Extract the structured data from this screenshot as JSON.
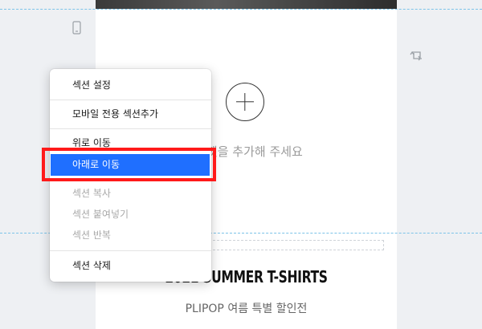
{
  "canvas": {
    "add_hint": "위젯을 추가해 주세요",
    "headline": "2021 SUMMER T-SHIRTS",
    "subline": "PLIPOP 여름 특별 할인전"
  },
  "icons": {
    "mobile": "mobile-device-icon",
    "swap": "swap-icon",
    "add": "plus-circle-icon"
  },
  "context_menu": {
    "items": [
      {
        "label": "섹션 설정",
        "enabled": true
      },
      {
        "label": "모바일 전용 섹션추가",
        "enabled": true
      },
      {
        "label": "위로 이동",
        "enabled": true
      },
      {
        "label": "아래로 이동",
        "enabled": true,
        "highlighted": true
      },
      {
        "label": "섹션 복사",
        "enabled": false
      },
      {
        "label": "섹션 붙여넣기",
        "enabled": false
      },
      {
        "label": "섹션 반복",
        "enabled": false
      },
      {
        "label": "섹션 삭제",
        "enabled": true
      }
    ]
  },
  "colors": {
    "highlight": "#1f6fff",
    "annotation": "#ff1a1a",
    "guide": "#7cc3e8"
  }
}
